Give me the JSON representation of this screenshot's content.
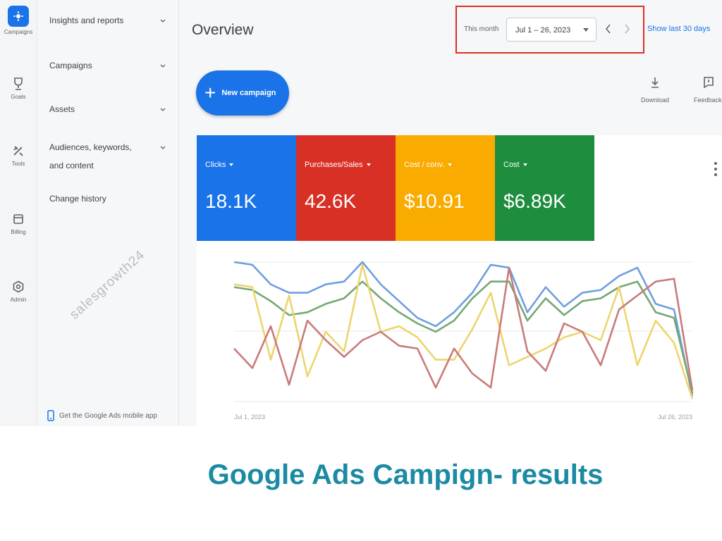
{
  "rail": [
    {
      "label": "Campaigns",
      "icon": "campaigns-icon",
      "active": true
    },
    {
      "label": "Goals",
      "icon": "trophy-icon"
    },
    {
      "label": "Tools",
      "icon": "tools-icon"
    },
    {
      "label": "Billing",
      "icon": "billing-icon"
    },
    {
      "label": "Admin",
      "icon": "admin-gear-icon"
    }
  ],
  "nav": {
    "items": [
      {
        "label": "Insights and reports"
      },
      {
        "label": "Campaigns"
      },
      {
        "label": "Assets"
      },
      {
        "label": "Audiences, keywords, and content"
      },
      {
        "label": "Change history"
      }
    ],
    "mobile_app_link": "Get the Google Ads mobile app"
  },
  "watermark": "salesgrowth24",
  "header": {
    "title": "Overview",
    "date_preset": "This month",
    "date_range": "Jul 1 – 26, 2023",
    "show_last": "Show last 30 days"
  },
  "toolbar": {
    "new_campaign": "New campaign",
    "download": "Download",
    "feedback": "Feedback"
  },
  "metrics": [
    {
      "label": "Clicks",
      "value": "18.1K",
      "color": "#1a73e8"
    },
    {
      "label": "Purchases/Sales",
      "value": "42.6K",
      "color": "#d93025"
    },
    {
      "label": "Cost / conv.",
      "value": "$10.91",
      "color": "#f9ab00"
    },
    {
      "label": "Cost",
      "value": "$6.89K",
      "color": "#1e8e3e"
    }
  ],
  "chart_data": {
    "type": "line",
    "x_start_label": "Jul 1, 2023",
    "x_end_label": "Jul 26, 2023",
    "x": [
      1,
      2,
      3,
      4,
      5,
      6,
      7,
      8,
      9,
      10,
      11,
      12,
      13,
      14,
      15,
      16,
      17,
      18,
      19,
      20,
      21,
      22,
      23,
      24,
      25,
      26
    ],
    "grid": true,
    "series": [
      {
        "color": "#6f9fe0",
        "values": [
          1.0,
          0.98,
          0.84,
          0.78,
          0.78,
          0.84,
          0.86,
          1.0,
          0.84,
          0.72,
          0.6,
          0.54,
          0.64,
          0.78,
          0.98,
          0.96,
          0.64,
          0.82,
          0.68,
          0.78,
          0.8,
          0.9,
          0.96,
          0.7,
          0.66,
          0.04
        ]
      },
      {
        "color": "#74a873",
        "values": [
          0.82,
          0.8,
          0.72,
          0.62,
          0.64,
          0.7,
          0.74,
          0.86,
          0.74,
          0.64,
          0.56,
          0.5,
          0.58,
          0.74,
          0.86,
          0.86,
          0.58,
          0.74,
          0.62,
          0.72,
          0.74,
          0.82,
          0.86,
          0.64,
          0.6,
          0.06
        ]
      },
      {
        "color": "#ecd56e",
        "values": [
          0.84,
          0.82,
          0.3,
          0.76,
          0.18,
          0.5,
          0.36,
          0.98,
          0.5,
          0.54,
          0.46,
          0.3,
          0.3,
          0.52,
          0.78,
          0.26,
          0.32,
          0.38,
          0.46,
          0.5,
          0.44,
          0.82,
          0.26,
          0.58,
          0.42,
          0.02
        ]
      },
      {
        "color": "#c97b7b",
        "values": [
          0.38,
          0.24,
          0.54,
          0.12,
          0.58,
          0.44,
          0.32,
          0.44,
          0.5,
          0.4,
          0.38,
          0.1,
          0.38,
          0.2,
          0.1,
          0.96,
          0.36,
          0.22,
          0.56,
          0.5,
          0.26,
          0.66,
          0.76,
          0.86,
          0.88,
          0.08
        ]
      }
    ]
  }
}
